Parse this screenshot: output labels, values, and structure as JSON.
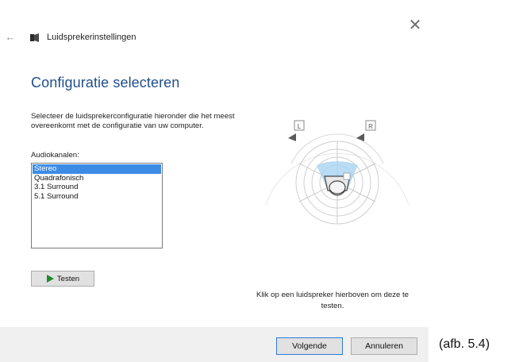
{
  "window": {
    "title": "Luidsprekerinstellingen",
    "close_glyph": "✕",
    "back_glyph": "←"
  },
  "main": {
    "heading": "Configuratie selecteren",
    "description": "Selecteer de luidsprekerconfiguratie hieronder die het meest overeenkomt met de configuratie van uw computer.",
    "channels_label": "Audiokanalen:",
    "channels": [
      {
        "label": "Stereo",
        "selected": true
      },
      {
        "label": "Quadrafonisch",
        "selected": false
      },
      {
        "label": "3.1 Surround",
        "selected": false
      },
      {
        "label": "5.1 Surround",
        "selected": false
      }
    ],
    "test_button": "Testen"
  },
  "diagram": {
    "left_label": "L",
    "right_label": "R",
    "hint": "Klik op een luidspreker hierboven om deze te testen."
  },
  "footer": {
    "next_button": "Volgende",
    "cancel_button": "Annuleren"
  },
  "caption": "(afb. 5.4)",
  "colors": {
    "accent": "#1f4e8c",
    "selection": "#3c8ce6",
    "play": "#1f8a2a",
    "footer_bg": "#f0f0f0"
  }
}
